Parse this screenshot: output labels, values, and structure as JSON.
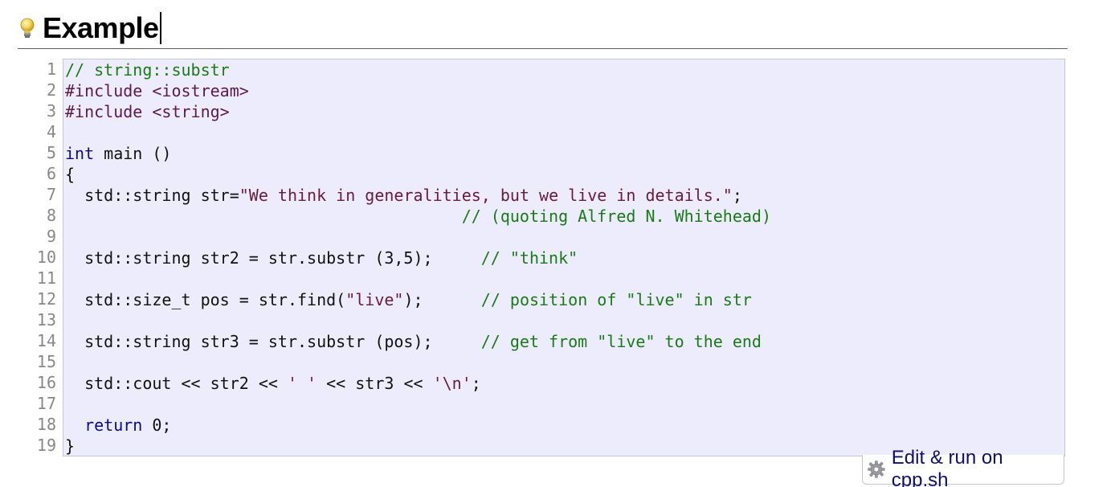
{
  "heading": {
    "title": "Example",
    "icon": "lightbulb-icon"
  },
  "code": {
    "line_numbers": [
      "1",
      "2",
      "3",
      "4",
      "5",
      "6",
      "7",
      "8",
      "9",
      "10",
      "11",
      "12",
      "13",
      "14",
      "15",
      "16",
      "17",
      "18",
      "19"
    ],
    "lines": [
      [
        {
          "t": "// string::substr",
          "k": "comment"
        }
      ],
      [
        {
          "t": "#include <iostream>",
          "k": "pp"
        }
      ],
      [
        {
          "t": "#include <string>",
          "k": "pp"
        }
      ],
      [
        {
          "t": "",
          "k": "plain"
        }
      ],
      [
        {
          "t": "int",
          "k": "kw"
        },
        {
          "t": " main ()",
          "k": "plain"
        }
      ],
      [
        {
          "t": "{",
          "k": "plain"
        }
      ],
      [
        {
          "t": "  std::string str=",
          "k": "plain"
        },
        {
          "t": "\"We think in generalities, but we live in details.\"",
          "k": "str"
        },
        {
          "t": ";",
          "k": "plain"
        }
      ],
      [
        {
          "t": "                                         ",
          "k": "plain"
        },
        {
          "t": "// (quoting Alfred N. Whitehead)",
          "k": "comment"
        }
      ],
      [
        {
          "t": "",
          "k": "plain"
        }
      ],
      [
        {
          "t": "  std::string str2 = str.substr (3,5);     ",
          "k": "plain"
        },
        {
          "t": "// \"think\"",
          "k": "comment"
        }
      ],
      [
        {
          "t": "",
          "k": "plain"
        }
      ],
      [
        {
          "t": "  std::size_t pos = str.find(",
          "k": "plain"
        },
        {
          "t": "\"live\"",
          "k": "str"
        },
        {
          "t": ");      ",
          "k": "plain"
        },
        {
          "t": "// position of \"live\" in str",
          "k": "comment"
        }
      ],
      [
        {
          "t": "",
          "k": "plain"
        }
      ],
      [
        {
          "t": "  std::string str3 = str.substr (pos);     ",
          "k": "plain"
        },
        {
          "t": "// get from \"live\" to the end",
          "k": "comment"
        }
      ],
      [
        {
          "t": "",
          "k": "plain"
        }
      ],
      [
        {
          "t": "  std::cout << str2 << ",
          "k": "plain"
        },
        {
          "t": "' '",
          "k": "str"
        },
        {
          "t": " << str3 << ",
          "k": "plain"
        },
        {
          "t": "'\\n'",
          "k": "str"
        },
        {
          "t": ";",
          "k": "plain"
        }
      ],
      [
        {
          "t": "",
          "k": "plain"
        }
      ],
      [
        {
          "t": "  ",
          "k": "plain"
        },
        {
          "t": "return",
          "k": "kw"
        },
        {
          "t": " 0;",
          "k": "plain"
        }
      ],
      [
        {
          "t": "}",
          "k": "plain"
        }
      ]
    ]
  },
  "run_button": {
    "label": "Edit & run on cpp.sh",
    "icon": "gear-icon"
  },
  "colors": {
    "code_background": "#ececfc",
    "comment": "#1a7a1a",
    "keyword": "#0a0a8a",
    "preprocessor": "#5a1a4a",
    "string": "#6a1a3a",
    "link": "#10106a"
  }
}
